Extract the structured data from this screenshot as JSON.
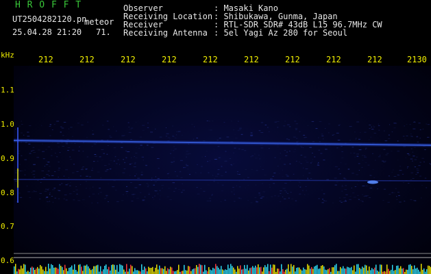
{
  "header": {
    "title": "H R O F F T",
    "filename": "UT2504282120.pn",
    "suffix": "meteor",
    "datetime": "25.04.28 21:20",
    "count": "71.",
    "fields": [
      {
        "label": "Observer",
        "value": ": Masaki Kano"
      },
      {
        "label": "Receiving Location",
        "value": ": Shibukawa, Gunma, Japan"
      },
      {
        "label": "Receiver",
        "value": ": RTL-SDR SDR# 43dB L15 96.7MHz CW"
      },
      {
        "label": "Receiving Antenna",
        "value": ": 5el Yagi Az 280 for Seoul"
      }
    ]
  },
  "axes": {
    "y_unit": "kHz",
    "x_ticks": [
      "212",
      "212",
      "212",
      "212",
      "212",
      "212",
      "212",
      "212",
      "212",
      "2130"
    ],
    "y_ticks": [
      "1.1",
      "1.0",
      "0.9",
      "0.8",
      "0.7",
      "0.6"
    ]
  },
  "colors": {
    "text_white": "#e8e8e8",
    "text_yellow": "#f2f000",
    "title_green": "#39c839",
    "signal": "#4a7dff"
  }
}
